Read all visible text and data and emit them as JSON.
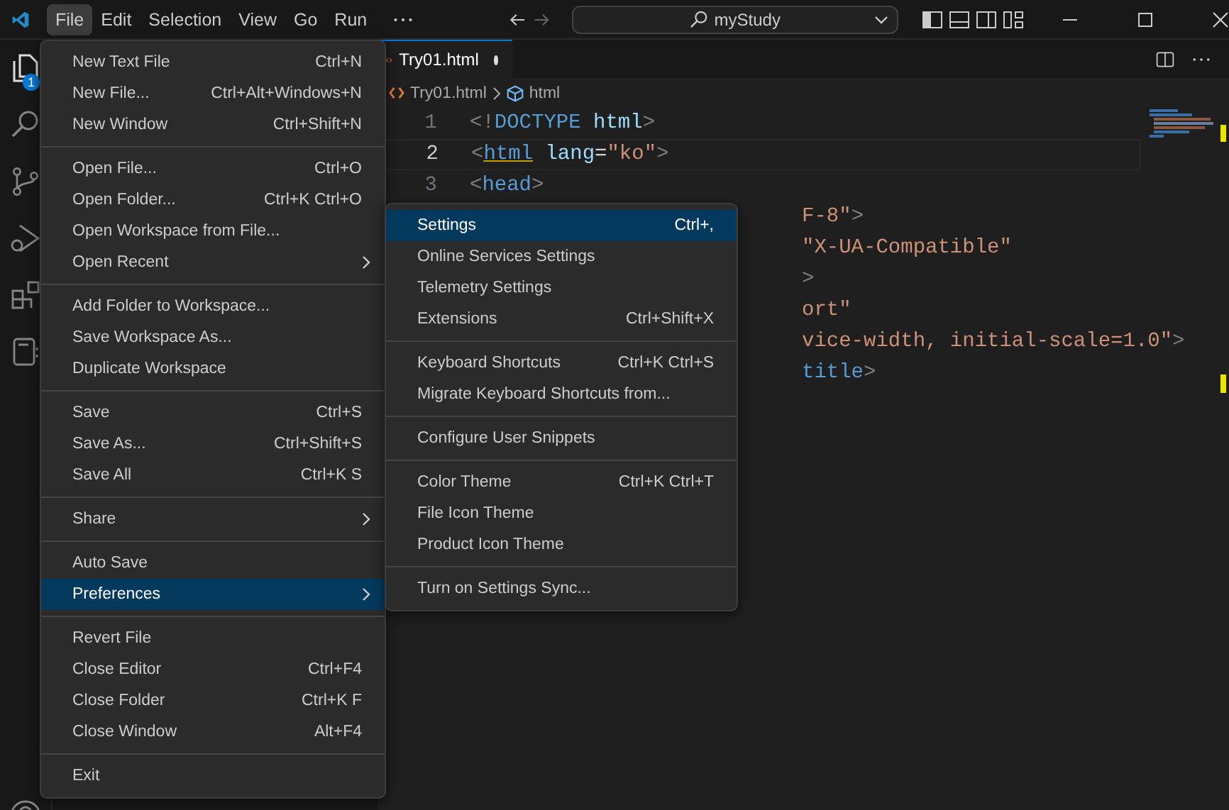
{
  "menubar": [
    {
      "label": "File",
      "selected": true
    },
    {
      "label": "Edit",
      "selected": false
    },
    {
      "label": "Selection",
      "selected": false
    },
    {
      "label": "View",
      "selected": false
    },
    {
      "label": "Go",
      "selected": false
    },
    {
      "label": "Run",
      "selected": false
    }
  ],
  "command_center": {
    "value": "myStudy"
  },
  "activity_bar": {
    "explorer_badge": "1"
  },
  "tabs": [
    {
      "label": "Try01.html",
      "selected": true,
      "modified": true
    }
  ],
  "breadcrumb": [
    "Try01.html",
    "html"
  ],
  "code_lines": [
    {
      "number": "1",
      "current": false,
      "tokens": [
        {
          "kind": "punct",
          "text": "<!"
        },
        {
          "kind": "tag",
          "text": "DOCTYPE"
        },
        {
          "kind": "attr",
          "text": " html"
        },
        {
          "kind": "punct",
          "text": ">"
        }
      ]
    },
    {
      "number": "2",
      "current": true,
      "tokens": [
        {
          "kind": "punct",
          "text": "<"
        },
        {
          "kind": "tag",
          "text": "html"
        },
        {
          "kind": "attr",
          "text": " lang"
        },
        {
          "kind": "text",
          "text": "="
        },
        {
          "kind": "string",
          "text": "\"ko\""
        },
        {
          "kind": "punct",
          "text": ">"
        }
      ]
    },
    {
      "number": "3",
      "current": false,
      "tokens": [
        {
          "kind": "punct",
          "text": "<"
        },
        {
          "kind": "tag",
          "text": "head"
        },
        {
          "kind": "punct",
          "text": ">"
        }
      ]
    },
    {
      "covered": true,
      "tokens": [
        {
          "kind": "string",
          "text": "F-8\""
        },
        {
          "kind": "punct",
          "text": ">"
        }
      ]
    },
    {
      "covered": true,
      "tokens": [
        {
          "kind": "string",
          "text": "\"X-UA-Compatible\""
        }
      ]
    },
    {
      "covered": true,
      "tokens": [
        {
          "kind": "punct",
          "text": ">"
        }
      ]
    },
    {
      "covered": true,
      "tokens": [
        {
          "kind": "string",
          "text": "ort\""
        }
      ]
    },
    {
      "covered": true,
      "tokens": [
        {
          "kind": "string",
          "text": "vice-width, initial-scale=1.0\""
        },
        {
          "kind": "punct",
          "text": ">"
        }
      ]
    },
    {
      "covered": true,
      "tokens": [
        {
          "kind": "tag",
          "text": "title"
        },
        {
          "kind": "punct",
          "text": ">"
        }
      ]
    }
  ],
  "file_menu": [
    {
      "kind": "item",
      "label": "New Text File",
      "shortcut": "Ctrl+N",
      "selected": false,
      "submenu": false
    },
    {
      "kind": "item",
      "label": "New File...",
      "shortcut": "Ctrl+Alt+Windows+N",
      "selected": false,
      "submenu": false
    },
    {
      "kind": "item",
      "label": "New Window",
      "shortcut": "Ctrl+Shift+N",
      "selected": false,
      "submenu": false
    },
    {
      "kind": "separator"
    },
    {
      "kind": "item",
      "label": "Open File...",
      "shortcut": "Ctrl+O",
      "selected": false,
      "submenu": false
    },
    {
      "kind": "item",
      "label": "Open Folder...",
      "shortcut": "Ctrl+K Ctrl+O",
      "selected": false,
      "submenu": false
    },
    {
      "kind": "item",
      "label": "Open Workspace from File...",
      "selected": false,
      "submenu": false
    },
    {
      "kind": "item",
      "label": "Open Recent",
      "selected": false,
      "submenu": true
    },
    {
      "kind": "separator"
    },
    {
      "kind": "item",
      "label": "Add Folder to Workspace...",
      "selected": false,
      "submenu": false
    },
    {
      "kind": "item",
      "label": "Save Workspace As...",
      "selected": false,
      "submenu": false
    },
    {
      "kind": "item",
      "label": "Duplicate Workspace",
      "selected": false,
      "submenu": false
    },
    {
      "kind": "separator"
    },
    {
      "kind": "item",
      "label": "Save",
      "shortcut": "Ctrl+S",
      "selected": false,
      "submenu": false
    },
    {
      "kind": "item",
      "label": "Save As...",
      "shortcut": "Ctrl+Shift+S",
      "selected": false,
      "submenu": false
    },
    {
      "kind": "item",
      "label": "Save All",
      "shortcut": "Ctrl+K S",
      "selected": false,
      "submenu": false
    },
    {
      "kind": "separator"
    },
    {
      "kind": "item",
      "label": "Share",
      "selected": false,
      "submenu": true
    },
    {
      "kind": "separator"
    },
    {
      "kind": "item",
      "label": "Auto Save",
      "selected": false,
      "submenu": false
    },
    {
      "kind": "item",
      "label": "Preferences",
      "selected": true,
      "submenu": true
    },
    {
      "kind": "separator"
    },
    {
      "kind": "item",
      "label": "Revert File",
      "selected": false,
      "submenu": false
    },
    {
      "kind": "item",
      "label": "Close Editor",
      "shortcut": "Ctrl+F4",
      "selected": false,
      "submenu": false
    },
    {
      "kind": "item",
      "label": "Close Folder",
      "shortcut": "Ctrl+K F",
      "selected": false,
      "submenu": false
    },
    {
      "kind": "item",
      "label": "Close Window",
      "shortcut": "Alt+F4",
      "selected": false,
      "submenu": false
    },
    {
      "kind": "separator"
    },
    {
      "kind": "item",
      "label": "Exit",
      "selected": false,
      "submenu": false
    }
  ],
  "preferences_menu": [
    {
      "kind": "item",
      "label": "Settings",
      "shortcut": "Ctrl+,",
      "selected": true,
      "submenu": false
    },
    {
      "kind": "item",
      "label": "Online Services Settings",
      "selected": false,
      "submenu": false
    },
    {
      "kind": "item",
      "label": "Telemetry Settings",
      "selected": false,
      "submenu": false
    },
    {
      "kind": "item",
      "label": "Extensions",
      "shortcut": "Ctrl+Shift+X",
      "selected": false,
      "submenu": false
    },
    {
      "kind": "separator"
    },
    {
      "kind": "item",
      "label": "Keyboard Shortcuts",
      "shortcut": "Ctrl+K Ctrl+S",
      "selected": false,
      "submenu": false
    },
    {
      "kind": "item",
      "label": "Migrate Keyboard Shortcuts from...",
      "selected": false,
      "submenu": false
    },
    {
      "kind": "separator"
    },
    {
      "kind": "item",
      "label": "Configure User Snippets",
      "selected": false,
      "submenu": false
    },
    {
      "kind": "separator"
    },
    {
      "kind": "item",
      "label": "Color Theme",
      "shortcut": "Ctrl+K Ctrl+T",
      "selected": false,
      "submenu": false
    },
    {
      "kind": "item",
      "label": "File Icon Theme",
      "selected": false,
      "submenu": false
    },
    {
      "kind": "item",
      "label": "Product Icon Theme",
      "selected": false,
      "submenu": false
    },
    {
      "kind": "separator"
    },
    {
      "kind": "item",
      "label": "Turn on Settings Sync...",
      "selected": false,
      "submenu": false
    }
  ]
}
